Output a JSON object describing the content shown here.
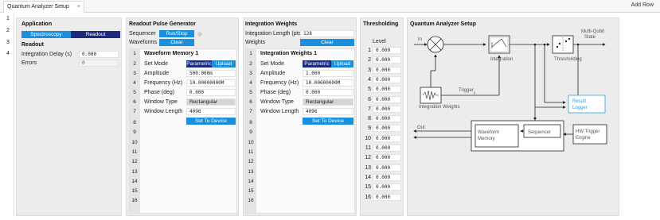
{
  "tabbar": {
    "tab_label": "Quantum Analyzer Setup",
    "close": "×",
    "add_row": "Add Row"
  },
  "rows": [
    "1",
    "2",
    "3",
    "4"
  ],
  "application": {
    "title": "Application",
    "mode_options": [
      "Spectroscopy",
      "Readout"
    ],
    "readout_title": "Readout",
    "integration_delay_label": "Integration Delay (s)",
    "integration_delay_value": "0.000",
    "errors_label": "Errors",
    "errors_value": "0"
  },
  "pulse": {
    "title": "Readout Pulse Generator",
    "sequencer_label": "Sequencer",
    "run_stop": "Run/Stop",
    "waveforms_label": "Waveforms",
    "clear": "Clear",
    "memory_title": "Waveform Memory 1",
    "set_mode_label": "Set Mode",
    "mode_options": [
      "Parametric",
      "Upload"
    ],
    "amplitude_label": "Amplitude",
    "amplitude_value": "500.000m",
    "frequency_label": "Frequency (Hz)",
    "frequency_value": "10.00000000M",
    "phase_label": "Phase (deg)",
    "phase_value": "0.000",
    "window_type_label": "Window Type",
    "window_type_value": "Rectangular",
    "window_length_label": "Window Length",
    "window_length_value": "4096",
    "set_to_device": "Set To Device"
  },
  "integration": {
    "title": "Integration Weights",
    "length_label": "Integration Length (pts)",
    "length_value": "128",
    "weights_label": "Weights",
    "clear": "Clear",
    "weights_title": "Integration Weights 1",
    "set_mode_label": "Set Mode",
    "mode_options": [
      "Parametric",
      "Upload"
    ],
    "amplitude_label": "Amplitude",
    "amplitude_value": "1.000",
    "frequency_label": "Frequency (Hz)",
    "frequency_value": "10.00000000M",
    "phase_label": "Phase (deg)",
    "phase_value": "0.000",
    "window_type_label": "Window Type",
    "window_type_value": "Rectangular",
    "window_length_label": "Window Length",
    "window_length_value": "4096",
    "set_to_device": "Set To Device"
  },
  "sub_rows": [
    "1",
    "2",
    "3",
    "4",
    "5",
    "6",
    "7",
    "8",
    "9",
    "10",
    "11",
    "12",
    "13",
    "14",
    "15",
    "16"
  ],
  "thresholding": {
    "title": "Thresholding",
    "level_label": "Level",
    "levels": [
      {
        "n": "1",
        "v": "0.000"
      },
      {
        "n": "2",
        "v": "0.000"
      },
      {
        "n": "3",
        "v": "0.000"
      },
      {
        "n": "4",
        "v": "0.000"
      },
      {
        "n": "5",
        "v": "0.000"
      },
      {
        "n": "6",
        "v": "0.000"
      },
      {
        "n": "7",
        "v": "0.000"
      },
      {
        "n": "8",
        "v": "0.000"
      },
      {
        "n": "9",
        "v": "0.000"
      },
      {
        "n": "10",
        "v": "0.000"
      },
      {
        "n": "11",
        "v": "0.000"
      },
      {
        "n": "12",
        "v": "0.000"
      },
      {
        "n": "13",
        "v": "0.000"
      },
      {
        "n": "14",
        "v": "0.000"
      },
      {
        "n": "15",
        "v": "0.000"
      },
      {
        "n": "16",
        "v": "0.000"
      }
    ]
  },
  "setup": {
    "title": "Quantum Analyzer Setup",
    "in": "In",
    "integration": "Integration",
    "thresholding": "Thresholding",
    "multi_qubit_state": [
      "Multi-Qubit",
      "State"
    ],
    "trigger": "Trigger",
    "integration_weights": "Integration Weights",
    "result_logger": [
      "Result",
      "Logger"
    ],
    "out": "Out",
    "waveform_memory": [
      "Waveform",
      "Memory"
    ],
    "sequencer": "Sequencer",
    "hw_trigger_engine": [
      "HW Trigger",
      "Engine"
    ]
  },
  "colors": {
    "accent_blue": "#1a8fdc",
    "navy": "#1c2b7d",
    "panel_bg": "#ececec",
    "result_logger": "#2aa0e0"
  }
}
